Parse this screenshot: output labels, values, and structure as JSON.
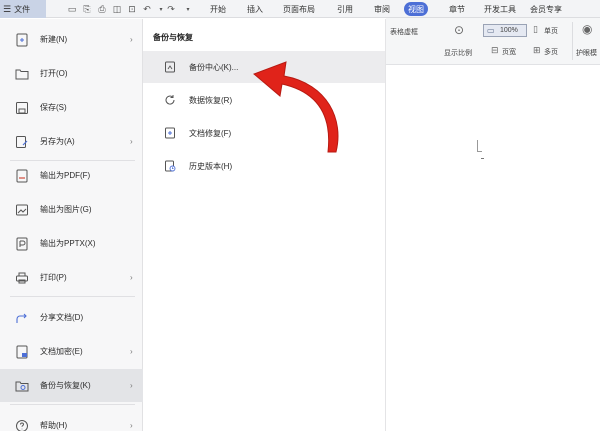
{
  "topbar": {
    "file_label": "文件",
    "tabs": [
      {
        "label": "开始"
      },
      {
        "label": "插入"
      },
      {
        "label": "页面布局"
      },
      {
        "label": "引用"
      },
      {
        "label": "审阅"
      },
      {
        "label": "视图",
        "active": true
      },
      {
        "label": "章节"
      },
      {
        "label": "开发工具"
      },
      {
        "label": "会员专享"
      }
    ]
  },
  "ribbon": {
    "table_gridlines": "表格虚框",
    "zoom_value": "100%",
    "single_page": "单页",
    "show_ratio": "显示比例",
    "page_width": "页宽",
    "multi_page": "多页",
    "eye_protect": "护眼模"
  },
  "left_menu": {
    "items": [
      {
        "label": "新建(N)",
        "icon": "new-file-icon",
        "arrow": true
      },
      {
        "label": "打开(O)",
        "icon": "folder-open-icon",
        "arrow": false
      },
      {
        "label": "保存(S)",
        "icon": "save-icon",
        "arrow": false
      },
      {
        "label": "另存为(A)",
        "icon": "save-as-icon",
        "arrow": true
      },
      {
        "label": "输出为PDF(F)",
        "icon": "export-pdf-icon",
        "arrow": false
      },
      {
        "label": "输出为图片(G)",
        "icon": "export-image-icon",
        "arrow": false
      },
      {
        "label": "输出为PPTX(X)",
        "icon": "export-pptx-icon",
        "arrow": false
      },
      {
        "label": "打印(P)",
        "icon": "print-icon",
        "arrow": true
      },
      {
        "label": "分享文档(D)",
        "icon": "share-icon",
        "arrow": false
      },
      {
        "label": "文档加密(E)",
        "icon": "encrypt-icon",
        "arrow": true
      },
      {
        "label": "备份与恢复(K)",
        "icon": "backup-restore-icon",
        "arrow": true,
        "selected": true
      },
      {
        "label": "帮助(H)",
        "icon": "help-icon",
        "arrow": true
      }
    ]
  },
  "submenu": {
    "title": "备份与恢复",
    "items": [
      {
        "label": "备份中心(K)...",
        "icon": "backup-center-icon",
        "hover": true
      },
      {
        "label": "数据恢复(R)",
        "icon": "data-recovery-icon"
      },
      {
        "label": "文档修复(F)",
        "icon": "document-repair-icon"
      },
      {
        "label": "历史版本(H)",
        "icon": "history-version-icon"
      }
    ]
  },
  "colors": {
    "accent": "#4d6fd6",
    "annotation_arrow": "#e0231a"
  }
}
